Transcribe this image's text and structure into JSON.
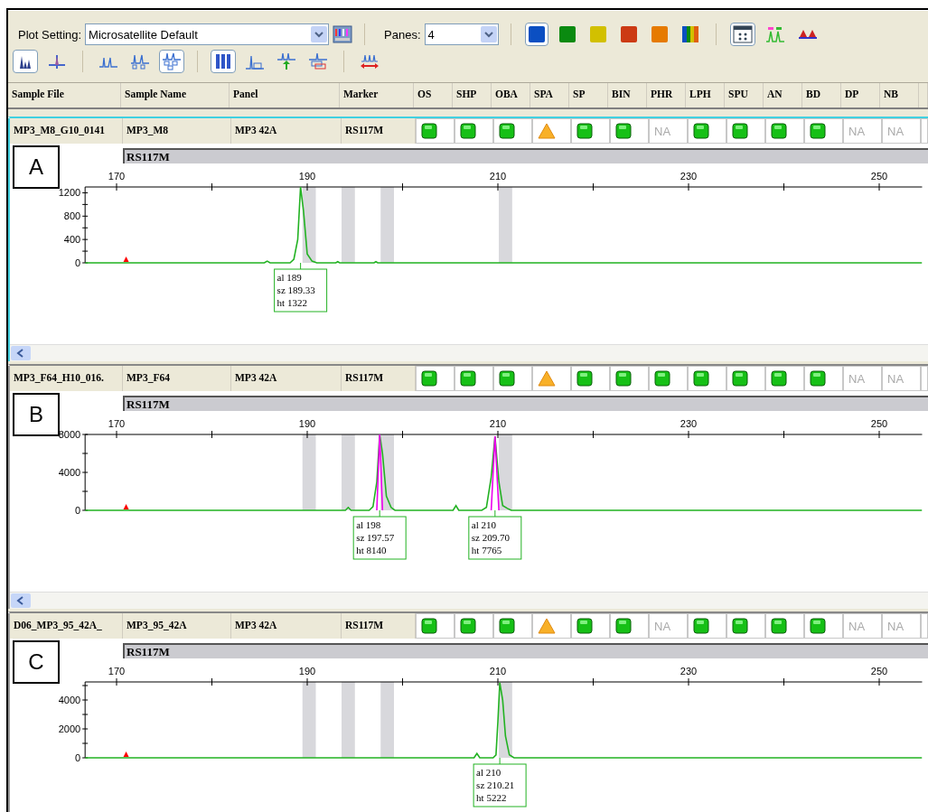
{
  "toolbar": {
    "plot_setting": {
      "label": "Plot Setting:",
      "value": "Microsatellite Default"
    },
    "panes": {
      "label": "Panes:",
      "value": "4"
    },
    "swatches": [
      {
        "kind": "solid",
        "color": "#0b4fc2",
        "selected": true
      },
      {
        "kind": "solid",
        "color": "#0a8a10",
        "selected": false
      },
      {
        "kind": "solid",
        "color": "#d2c000",
        "selected": false
      },
      {
        "kind": "solid",
        "color": "#cc3a14",
        "selected": false
      },
      {
        "kind": "solid",
        "color": "#e67a00",
        "selected": false
      },
      {
        "kind": "rainbow",
        "color": "#0b4fc2",
        "selected": false
      }
    ],
    "view_buttons": [
      {
        "kind": "table",
        "selected": true
      },
      {
        "kind": "labeled-peaks",
        "selected": false
      },
      {
        "kind": "triangles",
        "selected": false
      }
    ],
    "plot_buttons": [
      {
        "kind": "stacked-peaks",
        "selected": true
      },
      {
        "kind": "single-peak",
        "selected": false
      },
      {
        "kind": "peaks",
        "selected": false
      },
      {
        "kind": "peaks-boxes",
        "selected": false
      },
      {
        "kind": "peaks-grid",
        "selected": true
      },
      {
        "kind": "bars",
        "selected": true
      },
      {
        "kind": "peak-outline",
        "selected": false
      },
      {
        "kind": "peak-arrow",
        "selected": false
      },
      {
        "kind": "peak-overlay",
        "selected": false
      },
      {
        "kind": "range-arrow",
        "selected": false
      }
    ]
  },
  "columns": [
    "Sample File",
    "Sample Name",
    "Panel",
    "Marker",
    "OS",
    "SHP",
    "OBA",
    "SPA",
    "SP",
    "BIN",
    "PHR",
    "LPH",
    "SPU",
    "AN",
    "BD",
    "DP",
    "NB"
  ],
  "panes": [
    {
      "selected": true,
      "letter": "A",
      "sample_file": "MP3_M8_G10_0141",
      "sample_name": "MP3_M8",
      "panel": "MP3 42A",
      "marker": "RS117M",
      "marker_bar": "RS117M",
      "scrollbar": true,
      "flags": [
        {
          "kind": "pass"
        },
        {
          "kind": "pass"
        },
        {
          "kind": "pass"
        },
        {
          "kind": "check"
        },
        {
          "kind": "pass"
        },
        {
          "kind": "pass"
        },
        {
          "kind": "na",
          "text": "NA"
        },
        {
          "kind": "pass"
        },
        {
          "kind": "pass"
        },
        {
          "kind": "pass"
        },
        {
          "kind": "pass"
        },
        {
          "kind": "na",
          "text": "NA"
        },
        {
          "kind": "na",
          "text": "NA"
        }
      ],
      "peak_labels": [
        {
          "lines": [
            "al 189",
            "sz 189.33",
            "ht 1322"
          ]
        }
      ],
      "chart_data": {
        "type": "line",
        "xlim": [
          166.7,
          254.5
        ],
        "ylim": [
          0,
          1300
        ],
        "xticks": [
          170,
          190,
          210,
          230,
          250
        ],
        "yticks": [
          0,
          400,
          800,
          1200
        ],
        "x": [
          166.7,
          170,
          185.5,
          185.8,
          186.1,
          188.2,
          188.6,
          189,
          189.3,
          189.6,
          190,
          190.5,
          191,
          193,
          193.2,
          193.4,
          197,
          197.2,
          197.4,
          254.5
        ],
        "series": [
          {
            "color": "#22b222",
            "values": [
              0,
              0,
              0,
              30,
              0,
              0,
              60,
              400,
              1300,
              900,
              150,
              30,
              0,
              0,
              20,
              0,
              0,
              20,
              0,
              0
            ]
          }
        ]
      }
    },
    {
      "selected": false,
      "letter": "B",
      "sample_file": "MP3_F64_H10_016.",
      "sample_name": "MP3_F64",
      "panel": "MP3 42A",
      "marker": "RS117M",
      "marker_bar": "RS117M",
      "scrollbar": true,
      "flags": [
        {
          "kind": "pass"
        },
        {
          "kind": "pass"
        },
        {
          "kind": "pass"
        },
        {
          "kind": "check"
        },
        {
          "kind": "pass"
        },
        {
          "kind": "pass"
        },
        {
          "kind": "pass"
        },
        {
          "kind": "pass"
        },
        {
          "kind": "pass"
        },
        {
          "kind": "pass"
        },
        {
          "kind": "pass"
        },
        {
          "kind": "na",
          "text": "NA"
        },
        {
          "kind": "na",
          "text": "NA"
        }
      ],
      "peak_labels": [
        {
          "lines": [
            "al 198",
            "sz 197.57",
            "ht 8140"
          ]
        },
        {
          "lines": [
            "al 210",
            "sz 209.70",
            "ht 7765"
          ]
        }
      ],
      "chart_data": {
        "type": "line",
        "xlim": [
          166.7,
          254.5
        ],
        "ylim": [
          0,
          8000
        ],
        "xticks": [
          170,
          190,
          210,
          230,
          250
        ],
        "yticks": [
          0,
          4000,
          8000
        ],
        "x": [
          166.7,
          170,
          194,
          194.3,
          194.6,
          196.5,
          196.9,
          197.3,
          197.6,
          197.9,
          198.3,
          198.8,
          199.2,
          205.3,
          205.6,
          205.9,
          208.3,
          208.8,
          209.3,
          209.7,
          210.1,
          210.5,
          211,
          211.4,
          254.5
        ],
        "series": [
          {
            "color": "#22b222",
            "values": [
              0,
              0,
              0,
              300,
              0,
              0,
              400,
              3000,
              8000,
              6000,
              1500,
              300,
              0,
              0,
              500,
              0,
              0,
              300,
              3500,
              7800,
              3000,
              500,
              200,
              0,
              0
            ]
          },
          {
            "color": "#ee00ee",
            "values": [
              null,
              null,
              null,
              null,
              null,
              null,
              null,
              0,
              8000,
              0,
              null,
              null,
              null,
              null,
              null,
              null,
              null,
              null,
              0,
              7800,
              0,
              null,
              null,
              null,
              null
            ]
          }
        ]
      }
    },
    {
      "selected": false,
      "letter": "C",
      "sample_file": "D06_MP3_95_42A_",
      "sample_name": "MP3_95_42A",
      "panel": "MP3 42A",
      "marker": "RS117M",
      "marker_bar": "RS117M",
      "scrollbar": false,
      "flags": [
        {
          "kind": "pass"
        },
        {
          "kind": "pass"
        },
        {
          "kind": "pass"
        },
        {
          "kind": "check"
        },
        {
          "kind": "pass"
        },
        {
          "kind": "pass"
        },
        {
          "kind": "na",
          "text": "NA"
        },
        {
          "kind": "pass"
        },
        {
          "kind": "pass"
        },
        {
          "kind": "pass"
        },
        {
          "kind": "pass"
        },
        {
          "kind": "na",
          "text": "NA"
        },
        {
          "kind": "na",
          "text": "NA"
        }
      ],
      "peak_labels": [
        {
          "lines": [
            "al 210",
            "sz 210.21",
            "ht 5222"
          ]
        }
      ],
      "chart_data": {
        "type": "line",
        "xlim": [
          166.7,
          254.5
        ],
        "ylim": [
          0,
          5250
        ],
        "xticks": [
          170,
          190,
          210,
          230,
          250
        ],
        "yticks": [
          0,
          2000,
          4000
        ],
        "x": [
          166.7,
          170,
          207.5,
          207.8,
          208.1,
          209.5,
          209.8,
          210,
          210.2,
          210.5,
          210.8,
          211.2,
          211.7,
          254.5
        ],
        "series": [
          {
            "color": "#22b222",
            "values": [
              0,
              0,
              0,
              300,
              0,
              0,
              200,
              2500,
              5200,
              4000,
              1500,
              200,
              0,
              0
            ]
          }
        ]
      }
    }
  ]
}
